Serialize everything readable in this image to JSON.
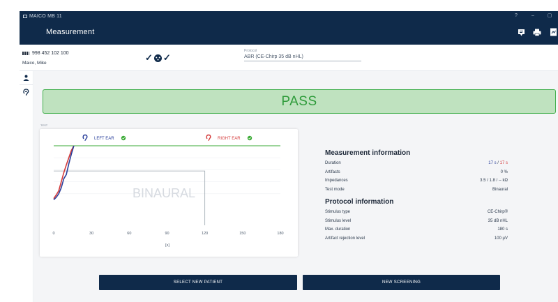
{
  "app": {
    "window_title": "MAICO MB 11",
    "header_title": "Measurement"
  },
  "patient": {
    "id": "998 452 102 100",
    "name": "Maico, Mike"
  },
  "protocol": {
    "label": "Protocol",
    "value": "ABR (CE-Chirp 35 dB nHL)"
  },
  "result": {
    "text": "PASS"
  },
  "test_label": "TEST",
  "chart": {
    "left_ear_label": "LEFT EAR",
    "right_ear_label": "RIGHT EAR",
    "overlay_text": "BINAURAL",
    "x_unit": "[s]"
  },
  "chart_data": {
    "type": "line",
    "title": "",
    "xlabel": "[s]",
    "ylabel": "",
    "xlim": [
      0,
      180
    ],
    "ylim": [
      0,
      100
    ],
    "x_ticks": [
      "0",
      "30",
      "60",
      "90",
      "120",
      "150",
      "180"
    ],
    "threshold_y": 100,
    "series": [
      {
        "name": "RIGHT EAR",
        "color": "#d43a3a",
        "x": [
          0,
          2,
          4,
          6,
          8,
          10,
          12,
          14,
          16
        ],
        "y": [
          12,
          18,
          25,
          40,
          55,
          68,
          80,
          92,
          100
        ]
      },
      {
        "name": "LEFT EAR",
        "color": "#2a3f9b",
        "x": [
          0,
          2,
          4,
          6,
          8,
          10,
          12,
          14,
          16
        ],
        "y": [
          10,
          14,
          20,
          30,
          45,
          52,
          70,
          86,
          100
        ]
      }
    ],
    "binaural_limit_x": 120,
    "binaural_limit_y": 58
  },
  "measurement_info": {
    "heading": "Measurement information",
    "rows": [
      {
        "label": "Duration",
        "value_left": "17 s",
        "sep": " / ",
        "value_right": "17 s"
      },
      {
        "label": "Artifacts",
        "value": "0 %"
      },
      {
        "label": "Impedances",
        "value": "3.5 / 1.8 / -- kΩ"
      },
      {
        "label": "Test mode",
        "value": "Binaural"
      }
    ]
  },
  "protocol_info": {
    "heading": "Protocol information",
    "rows": [
      {
        "label": "Stimulus type",
        "value": "CE-Chirp®"
      },
      {
        "label": "Stimulus level",
        "value": "35 dB nHL"
      },
      {
        "label": "Max. duration",
        "value": "180 s"
      },
      {
        "label": "Artifact rejection level",
        "value": "100 µV"
      }
    ]
  },
  "buttons": {
    "select_new_patient": "SELECT NEW PATIENT",
    "new_screening": "NEW SCREENING"
  },
  "window_controls": {
    "help": "?",
    "minimize": "–",
    "maximize": "▢"
  },
  "colors": {
    "navy": "#0f2a4a",
    "pass_green": "#2e9b3a",
    "pass_bg": "#bfe2bf",
    "right_ear_red": "#d43a3a",
    "left_ear_blue": "#2a3f9b",
    "ok_green": "#3aaa35"
  },
  "icons": {
    "header": [
      "report-icon",
      "print-icon",
      "export-icon"
    ],
    "sidebar": [
      "patient-icon",
      "ear-icon"
    ]
  }
}
